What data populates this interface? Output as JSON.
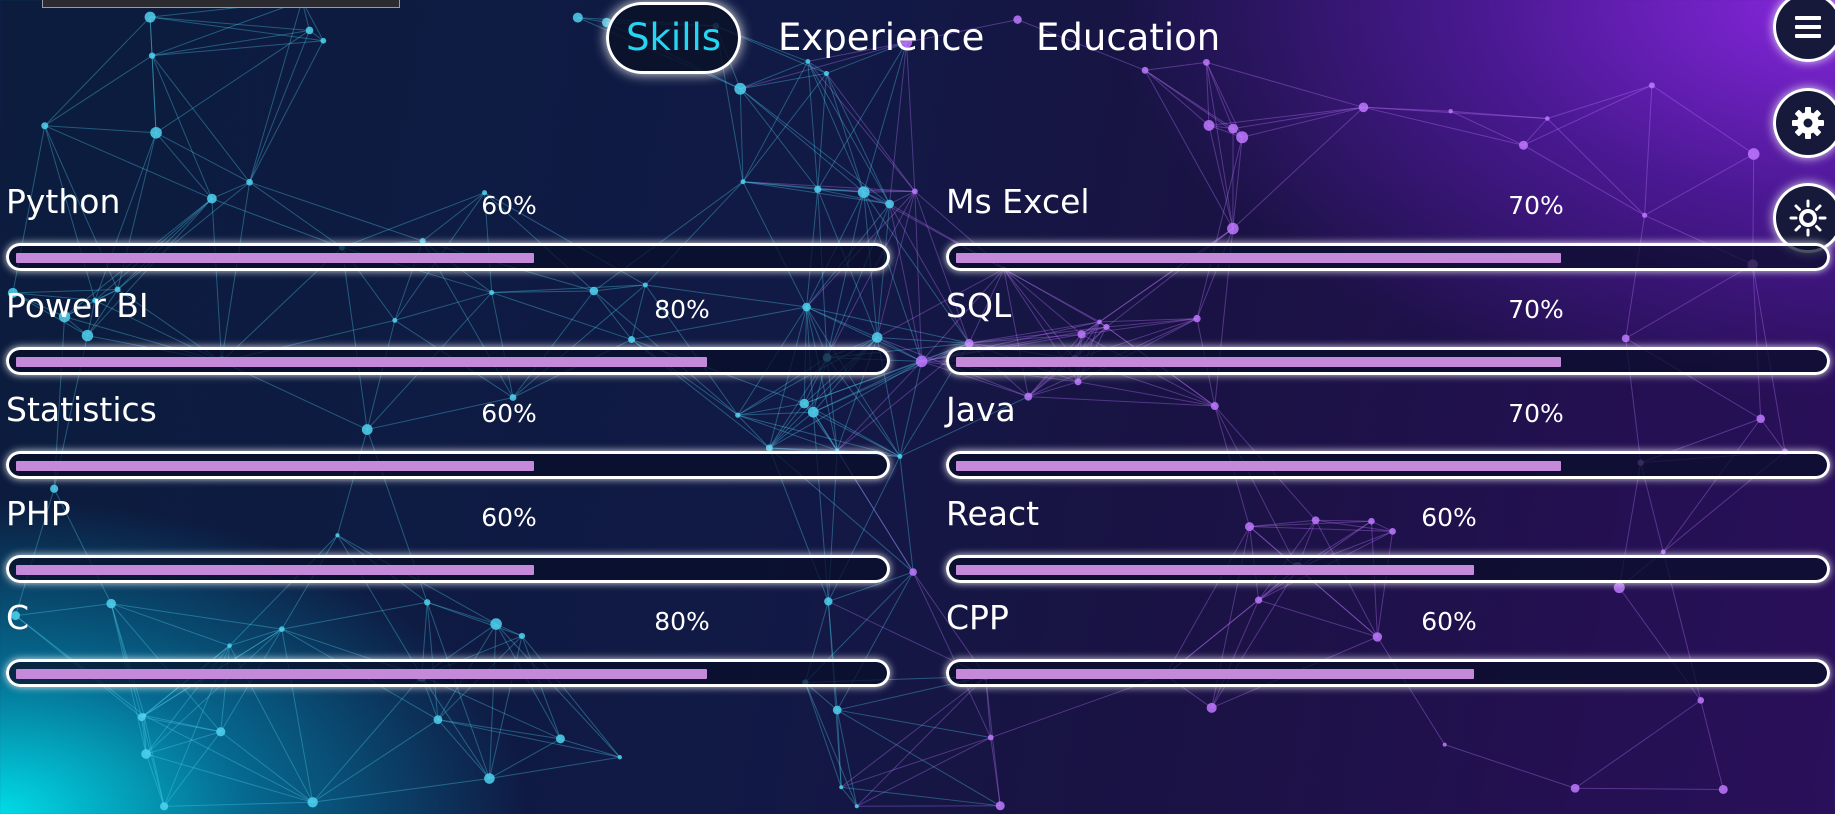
{
  "nav": {
    "tabs": [
      {
        "label": "Skills",
        "active": true
      },
      {
        "label": "Experience",
        "active": false
      },
      {
        "label": "Education",
        "active": false
      }
    ]
  },
  "side_buttons": [
    {
      "icon": "menu-icon"
    },
    {
      "icon": "gear-icon"
    },
    {
      "icon": "sun-icon"
    }
  ],
  "colors": {
    "accent": "#24d6f2",
    "bar_fill": "#c48ad9"
  },
  "skills": [
    {
      "name": "Python",
      "percent_label": "60%",
      "level": 0.6
    },
    {
      "name": "Ms Excel",
      "percent_label": "70%",
      "level": 0.7
    },
    {
      "name": "Power BI",
      "percent_label": "80%",
      "level": 0.8
    },
    {
      "name": "SQL",
      "percent_label": "70%",
      "level": 0.7
    },
    {
      "name": "Statistics",
      "percent_label": "60%",
      "level": 0.6
    },
    {
      "name": "Java",
      "percent_label": "70%",
      "level": 0.7
    },
    {
      "name": "PHP",
      "percent_label": "60%",
      "level": 0.6
    },
    {
      "name": "React",
      "percent_label": "60%",
      "level": 0.6
    },
    {
      "name": "C",
      "percent_label": "80%",
      "level": 0.8
    },
    {
      "name": "CPP",
      "percent_label": "60%",
      "level": 0.6
    }
  ]
}
